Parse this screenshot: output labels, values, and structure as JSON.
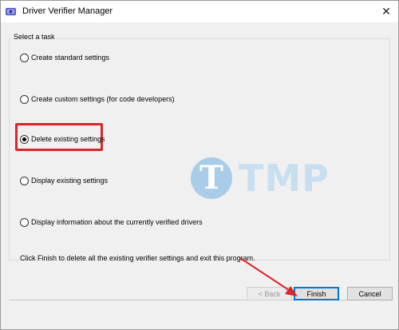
{
  "window": {
    "title": "Driver Verifier Manager",
    "close_glyph": "✕"
  },
  "group": {
    "title": "Select a task"
  },
  "options": [
    {
      "label": "Create standard settings",
      "selected": false
    },
    {
      "label": "Create custom settings (for code developers)",
      "selected": false
    },
    {
      "label": "Delete existing settings",
      "selected": true
    },
    {
      "label": "Display existing settings",
      "selected": false
    },
    {
      "label": "Display information about the currently verified drivers",
      "selected": false
    }
  ],
  "info_text": "Click Finish to delete all the existing verifier settings and exit this program.",
  "buttons": {
    "back": "< Back",
    "finish": "Finish",
    "cancel": "Cancel"
  },
  "watermark": {
    "letter": "T",
    "text": "TMP"
  },
  "colors": {
    "highlight": "#d9272b",
    "accent": "#0078d7"
  }
}
